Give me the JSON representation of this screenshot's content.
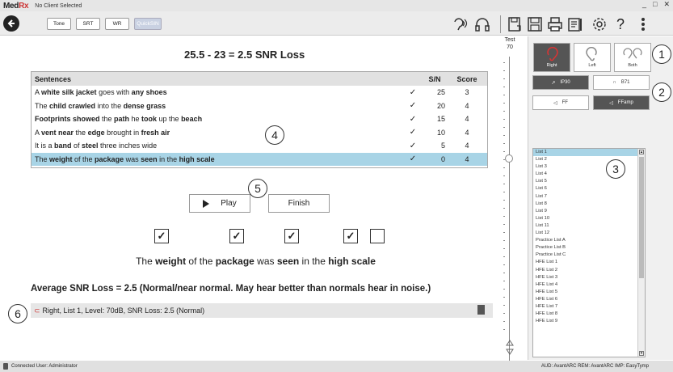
{
  "app": {
    "logo_main": "Med",
    "logo_rx": "Rx",
    "client_status": "No Client Selected",
    "window_controls": [
      "_",
      "□",
      "✕"
    ]
  },
  "toolbar": {
    "mode_buttons": [
      "Tone",
      "SRT",
      "WR",
      "QuickSIN"
    ],
    "active_mode": "QuickSIN",
    "icons": [
      "talkover-icon",
      "listen-icon",
      "save-session-icon",
      "save-icon",
      "print-icon",
      "report-icon",
      "settings-icon",
      "help-icon",
      "more-menu-icon"
    ]
  },
  "test_result": {
    "formula": "25.5 - 23 = 2.5 SNR Loss"
  },
  "sentences_table": {
    "headers": {
      "sentences": "Sentences",
      "sn": "S/N",
      "score": "Score"
    },
    "rows": [
      {
        "parts": [
          [
            "A ",
            false
          ],
          [
            "white silk jacket",
            true
          ],
          [
            " goes with ",
            false
          ],
          [
            "any shoes",
            true
          ]
        ],
        "check": "✓",
        "sn": "25",
        "score": "3",
        "selected": false
      },
      {
        "parts": [
          [
            "The ",
            false
          ],
          [
            "child crawled",
            true
          ],
          [
            " into the ",
            false
          ],
          [
            "dense grass",
            true
          ]
        ],
        "check": "✓",
        "sn": "20",
        "score": "4",
        "selected": false
      },
      {
        "parts": [
          [
            "Footprints showed",
            true
          ],
          [
            " the ",
            false
          ],
          [
            "path",
            true
          ],
          [
            " he ",
            false
          ],
          [
            "took",
            true
          ],
          [
            " up the ",
            false
          ],
          [
            "beach",
            true
          ]
        ],
        "check": "✓",
        "sn": "15",
        "score": "4",
        "selected": false
      },
      {
        "parts": [
          [
            "A ",
            false
          ],
          [
            "vent near",
            true
          ],
          [
            " the ",
            false
          ],
          [
            "edge",
            true
          ],
          [
            " brought in ",
            false
          ],
          [
            "fresh air",
            true
          ]
        ],
        "check": "✓",
        "sn": "10",
        "score": "4",
        "selected": false
      },
      {
        "parts": [
          [
            "It is a ",
            false
          ],
          [
            "band",
            true
          ],
          [
            " of ",
            false
          ],
          [
            "steel",
            true
          ],
          [
            " three inches wide",
            false
          ]
        ],
        "check": "✓",
        "sn": "5",
        "score": "4",
        "selected": false
      },
      {
        "parts": [
          [
            "The ",
            false
          ],
          [
            "weight",
            true
          ],
          [
            " of the ",
            false
          ],
          [
            "package",
            true
          ],
          [
            " was ",
            false
          ],
          [
            "seen",
            true
          ],
          [
            " in the ",
            false
          ],
          [
            "high scale",
            true
          ]
        ],
        "check": "✓",
        "sn": "0",
        "score": "4",
        "selected": true
      }
    ]
  },
  "controls": {
    "play_label": "Play",
    "finish_label": "Finish"
  },
  "keyword_checkboxes": [
    true,
    true,
    true,
    true,
    false
  ],
  "current_sentence": [
    [
      "The ",
      false
    ],
    [
      "weight",
      true
    ],
    [
      " of the ",
      false
    ],
    [
      "package",
      true
    ],
    [
      " was ",
      false
    ],
    [
      "seen",
      true
    ],
    [
      " in the ",
      false
    ],
    [
      "high scale",
      true
    ]
  ],
  "average_line": "Average SNR Loss = 2.5 (Normal/near normal. May hear better than normals hear in noise.)",
  "history": {
    "entry": "Right, List 1, Level: 70dB, SNR Loss: 2.5 (Normal)"
  },
  "level": {
    "label": "Test",
    "value": "70"
  },
  "ear_selection": {
    "options": [
      "Right",
      "Left",
      "Both"
    ],
    "active": "Right"
  },
  "transducers": {
    "row1": [
      "IP30",
      "B71"
    ],
    "row2": [
      "FF",
      "FFamp"
    ],
    "active": [
      "IP30",
      "FFamp"
    ]
  },
  "lists": {
    "items": [
      "List 1",
      "List 2",
      "List 3",
      "List 4",
      "List 5",
      "List 6",
      "List 7",
      "List 8",
      "List 9",
      "List 10",
      "List 11",
      "List 12",
      "Practice List A",
      "Practice List B",
      "Practice List C",
      "HFE List 1",
      "HFE List 2",
      "HFE List 3",
      "HFE List 4",
      "HFE List 5",
      "HFE List 6",
      "HFE List 7",
      "HFE List 8",
      "HFE List 9"
    ],
    "selected": "List 1"
  },
  "callouts": [
    "1",
    "2",
    "3",
    "4",
    "5",
    "6"
  ],
  "status": {
    "left": "Connected  User: Administrator",
    "right": "AUD: AvantARC  REM: AvantARC  IMP: EasyTymp"
  }
}
